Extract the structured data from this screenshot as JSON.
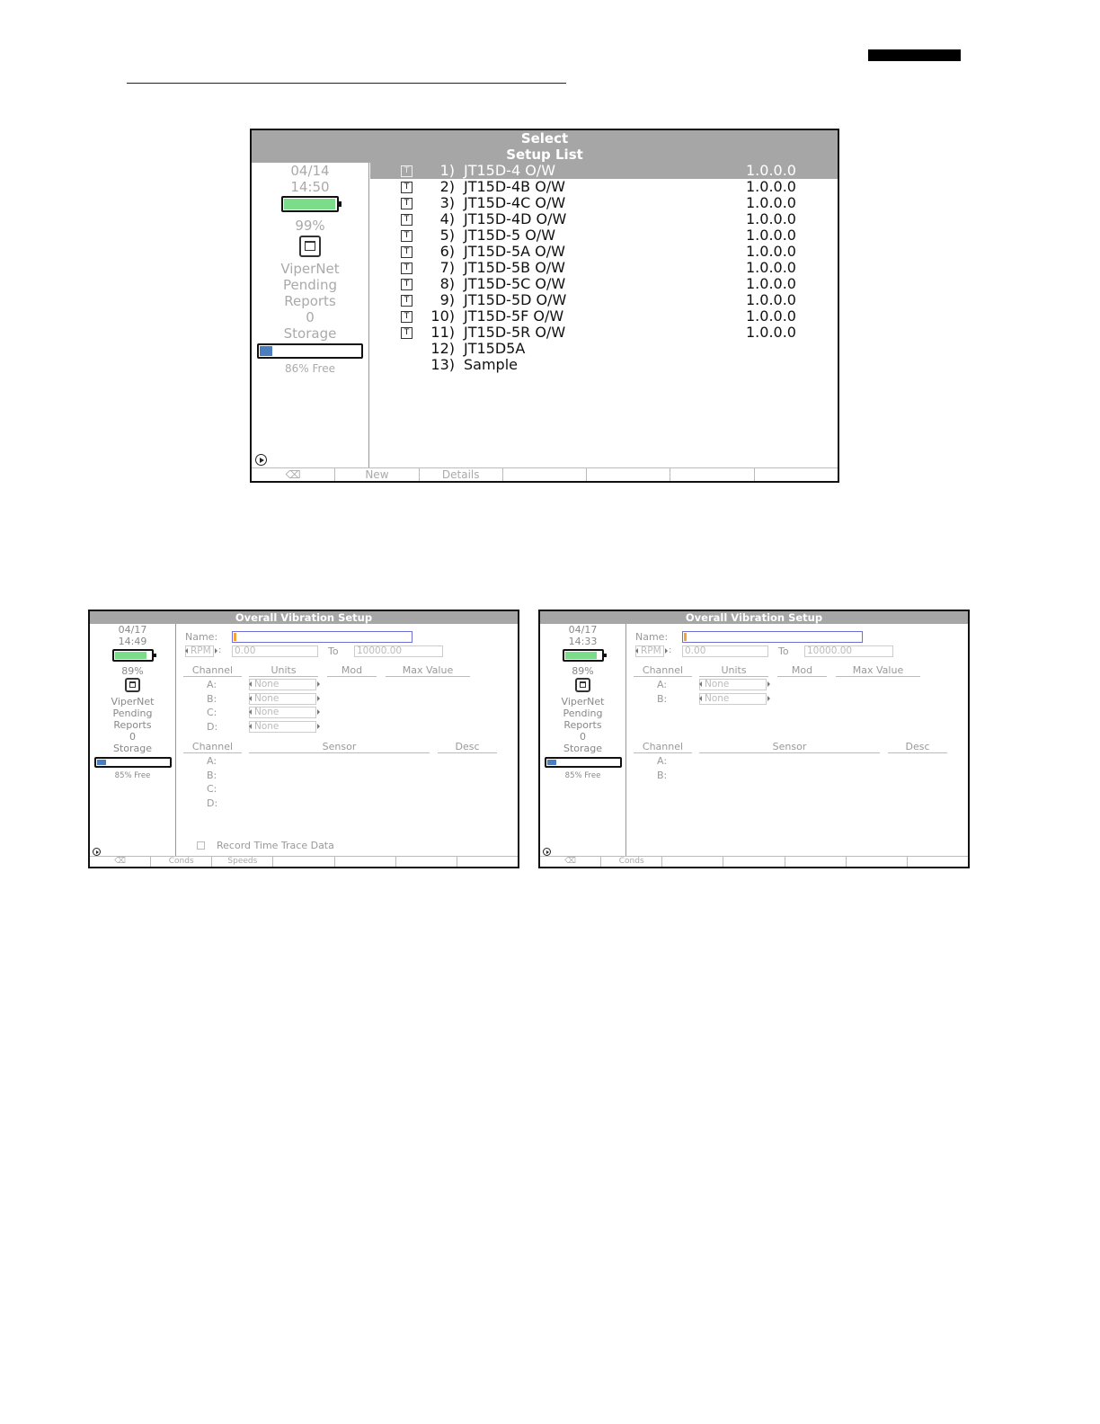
{
  "screen1": {
    "title_line1": "Select",
    "title_line2": "Setup List",
    "sidebar": {
      "date": "04/14",
      "time": "14:50",
      "battery_percent_label": "99%",
      "battery_level": 0.99,
      "network_label": "ViperNet",
      "pending_label": "Pending",
      "reports_label": "Reports",
      "reports_count": "0",
      "storage_label": "Storage",
      "storage_used_fraction": 0.14,
      "storage_free_label": "86% Free"
    },
    "setups": [
      {
        "num": "1)",
        "name": "JT15D-4 O/W",
        "version": "1.0.0.0",
        "tag": "T",
        "selected": true
      },
      {
        "num": "2)",
        "name": "JT15D-4B O/W",
        "version": "1.0.0.0",
        "tag": "T"
      },
      {
        "num": "3)",
        "name": "JT15D-4C O/W",
        "version": "1.0.0.0",
        "tag": "T"
      },
      {
        "num": "4)",
        "name": "JT15D-4D O/W",
        "version": "1.0.0.0",
        "tag": "T"
      },
      {
        "num": "5)",
        "name": "JT15D-5 O/W",
        "version": "1.0.0.0",
        "tag": "T"
      },
      {
        "num": "6)",
        "name": "JT15D-5A O/W",
        "version": "1.0.0.0",
        "tag": "T"
      },
      {
        "num": "7)",
        "name": "JT15D-5B O/W",
        "version": "1.0.0.0",
        "tag": "T"
      },
      {
        "num": "8)",
        "name": "JT15D-5C O/W",
        "version": "1.0.0.0",
        "tag": "T"
      },
      {
        "num": "9)",
        "name": "JT15D-5D O/W",
        "version": "1.0.0.0",
        "tag": "T"
      },
      {
        "num": "10)",
        "name": "JT15D-5F O/W",
        "version": "1.0.0.0",
        "tag": "T"
      },
      {
        "num": "11)",
        "name": "JT15D-5R O/W",
        "version": "1.0.0.0",
        "tag": "T"
      },
      {
        "num": "12)",
        "name": "JT15D5A",
        "version": "",
        "tag": ""
      },
      {
        "num": "13)",
        "name": "Sample",
        "version": "",
        "tag": ""
      }
    ],
    "softkeys": [
      "⌫",
      "New",
      "Details",
      "",
      "",
      "",
      ""
    ]
  },
  "screen2": {
    "title": "Overall Vibration Setup",
    "sidebar": {
      "date": "04/17",
      "time": "14:49",
      "battery_percent_label": "89%",
      "battery_level": 0.89,
      "network_label": "ViperNet",
      "pending_label": "Pending",
      "reports_label": "Reports",
      "reports_count": "0",
      "storage_label": "Storage",
      "storage_used_fraction": 0.15,
      "storage_free_label": "85% Free"
    },
    "name_label": "Name:",
    "name_value": "",
    "speed_unit": "RPM",
    "range_from": "0.00",
    "to_label": "To",
    "range_to": "10000.00",
    "headers_top": {
      "channel": "Channel",
      "units": "Units",
      "mod": "Mod",
      "max_value": "Max Value"
    },
    "channels_top": [
      {
        "label": "A:",
        "units": "None"
      },
      {
        "label": "B:",
        "units": "None"
      },
      {
        "label": "C:",
        "units": "None"
      },
      {
        "label": "D:",
        "units": "None"
      }
    ],
    "headers_bottom": {
      "channel": "Channel",
      "sensor": "Sensor",
      "desc": "Desc"
    },
    "channels_bottom": [
      "A:",
      "B:",
      "C:",
      "D:"
    ],
    "record_label": "Record Time Trace Data",
    "softkeys": [
      "⌫",
      "Conds",
      "Speeds",
      "",
      "",
      "",
      ""
    ]
  },
  "screen3": {
    "title": "Overall Vibration Setup",
    "sidebar": {
      "date": "04/17",
      "time": "14:33",
      "battery_percent_label": "89%",
      "battery_level": 0.89,
      "network_label": "ViperNet",
      "pending_label": "Pending",
      "reports_label": "Reports",
      "reports_count": "0",
      "storage_label": "Storage",
      "storage_used_fraction": 0.15,
      "storage_free_label": "85% Free"
    },
    "name_label": "Name:",
    "name_value": "",
    "speed_unit": "RPM",
    "range_from": "0.00",
    "to_label": "To",
    "range_to": "10000.00",
    "headers_top": {
      "channel": "Channel",
      "units": "Units",
      "mod": "Mod",
      "max_value": "Max Value"
    },
    "channels_top": [
      {
        "label": "A:",
        "units": "None"
      },
      {
        "label": "B:",
        "units": "None"
      }
    ],
    "headers_bottom": {
      "channel": "Channel",
      "sensor": "Sensor",
      "desc": "Desc"
    },
    "channels_bottom": [
      "A:",
      "B:"
    ],
    "softkeys": [
      "⌫",
      "Conds",
      "",
      "",
      "",
      "",
      ""
    ]
  }
}
